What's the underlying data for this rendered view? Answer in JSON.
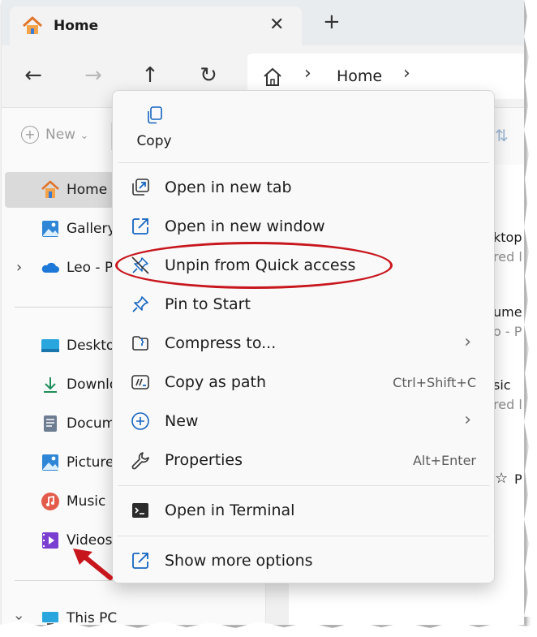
{
  "window": {
    "tab": {
      "title": "Home",
      "icon": "home-icon",
      "close_icon": "close-icon"
    },
    "new_tab_icon": "plus-icon"
  },
  "nav": {
    "back_icon": "back-arrow-icon",
    "forward_icon": "forward-arrow-icon",
    "up_icon": "up-arrow-icon",
    "refresh_icon": "refresh-icon",
    "address": {
      "home_icon": "home-icon",
      "crumb": "Home",
      "separator": "›"
    }
  },
  "toolbar": {
    "new_label": "New",
    "new_chevron": "⌄"
  },
  "sidebar": {
    "pinned": [
      {
        "label": "Home",
        "icon": "home-icon",
        "selected": true
      },
      {
        "label": "Gallery",
        "icon": "gallery-icon"
      },
      {
        "label": "Leo - Pe",
        "icon": "onedrive-cloud-icon",
        "expandable": true
      }
    ],
    "quick": [
      {
        "label": "Deskto"
      },
      {
        "label": "Downlo"
      },
      {
        "label": "Docum"
      },
      {
        "label": "Pictures"
      },
      {
        "label": "Music"
      },
      {
        "label": "Videos"
      }
    ],
    "this_pc": {
      "label": "This PC"
    }
  },
  "content_fragments": [
    {
      "text": "ktop"
    },
    {
      "text": "red l"
    },
    {
      "text": "ume"
    },
    {
      "text": "o - P"
    },
    {
      "text": "sic"
    },
    {
      "text": "red l"
    },
    {
      "text": "P"
    }
  ],
  "context_menu": {
    "quick_action": {
      "label": "Copy",
      "icon": "copy-icon"
    },
    "items": [
      {
        "label": "Open in new tab",
        "icon": "open-new-tab-icon",
        "shortcut": "",
        "submenu": false
      },
      {
        "label": "Open in new window",
        "icon": "open-new-window-icon",
        "shortcut": "",
        "submenu": false
      },
      {
        "label": "Unpin from Quick access",
        "icon": "unpin-icon",
        "shortcut": "",
        "submenu": false
      },
      {
        "label": "Pin to Start",
        "icon": "pin-icon",
        "shortcut": "",
        "submenu": false
      },
      {
        "label": "Compress to...",
        "icon": "zip-folder-icon",
        "shortcut": "",
        "submenu": true
      },
      {
        "label": "Copy as path",
        "icon": "copy-path-icon",
        "shortcut": "Ctrl+Shift+C",
        "submenu": false
      },
      {
        "label": "New",
        "icon": "new-plus-icon",
        "shortcut": "",
        "submenu": true
      },
      {
        "label": "Properties",
        "icon": "wrench-icon",
        "shortcut": "Alt+Enter",
        "submenu": false
      }
    ],
    "terminal": {
      "label": "Open in Terminal",
      "icon": "terminal-icon"
    },
    "more": {
      "label": "Show more options",
      "icon": "show-more-icon"
    }
  },
  "colors": {
    "accent": "#0067c0",
    "highlight_annotation": "#c8161d",
    "selected_bg": "#dadada"
  }
}
